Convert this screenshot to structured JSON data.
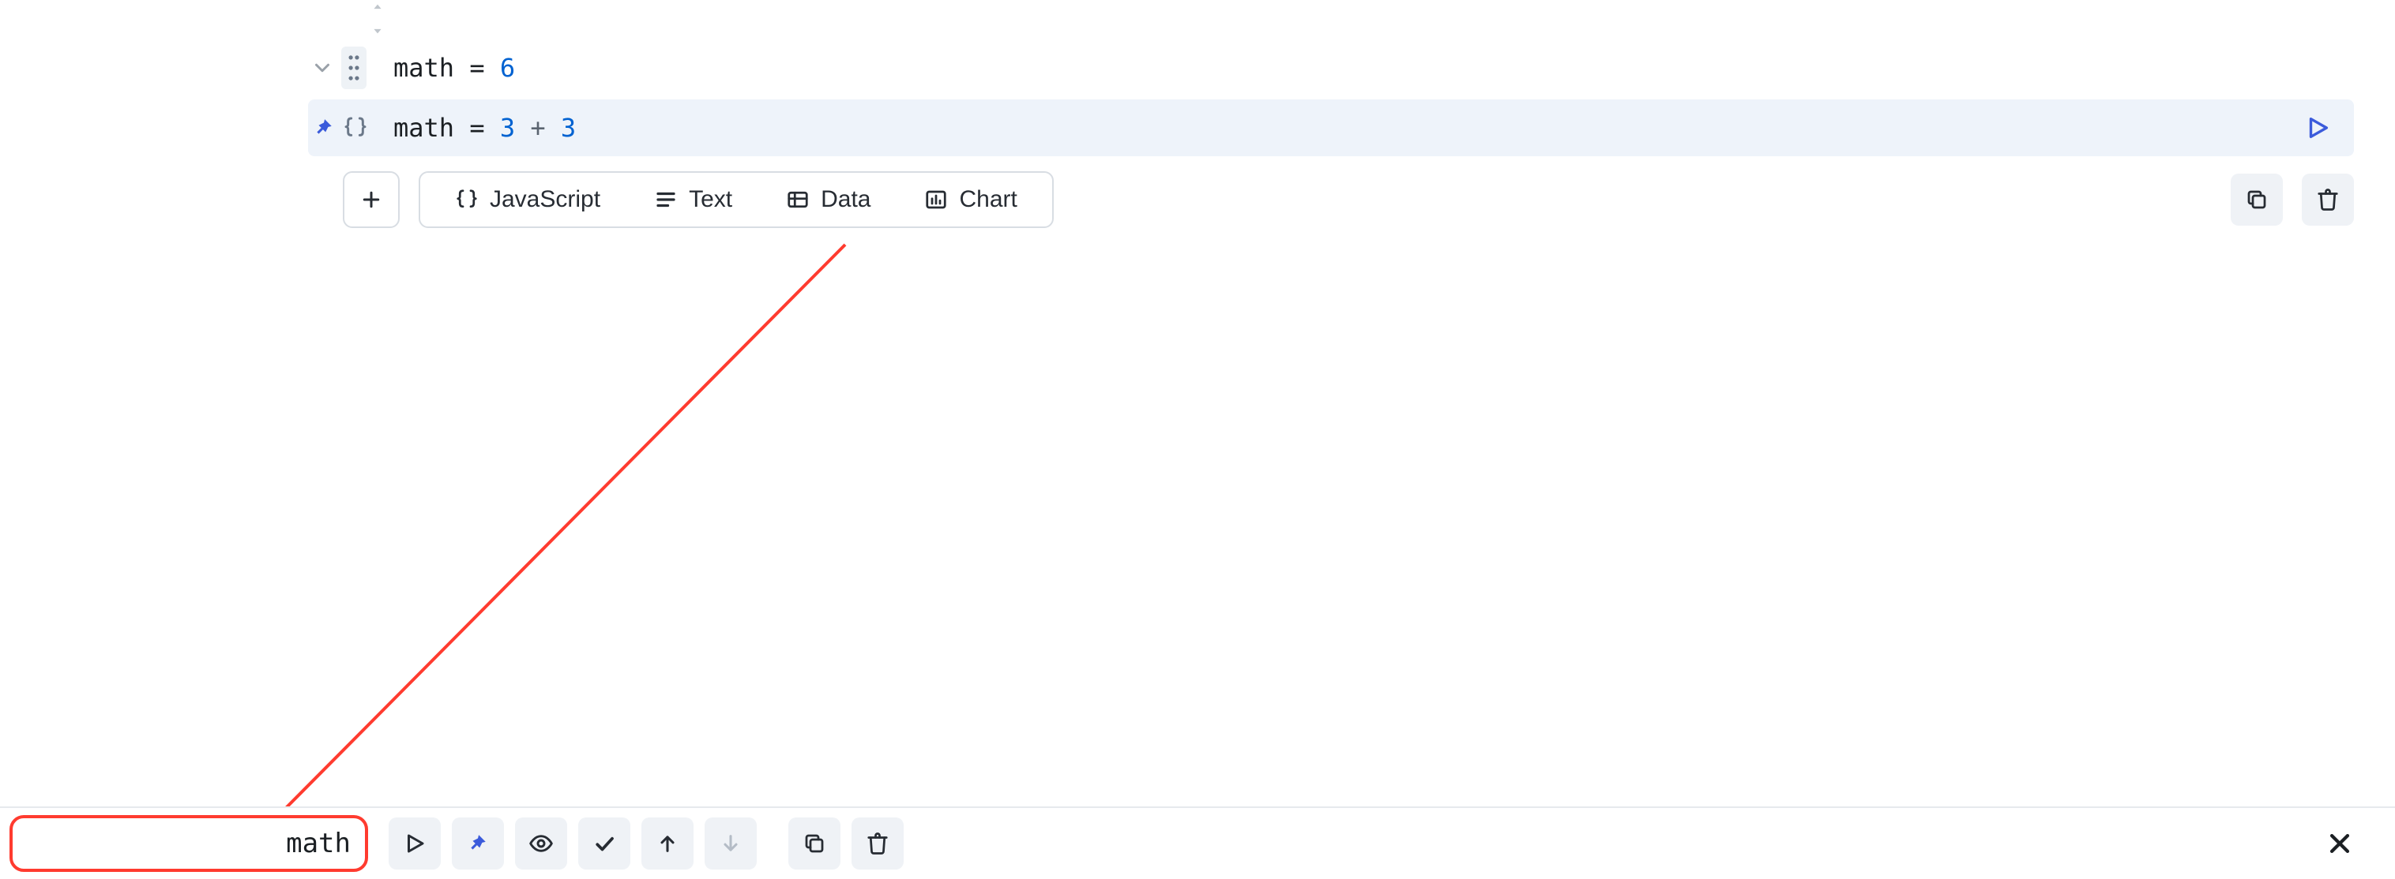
{
  "cell": {
    "result": {
      "name": "math",
      "eq": "=",
      "value": "6"
    },
    "source": {
      "name": "math",
      "eq": "=",
      "lhs": "3",
      "op": "+",
      "rhs": "3"
    }
  },
  "insert_menu": {
    "javascript": "JavaScript",
    "text": "Text",
    "data": "Data",
    "chart": "Chart"
  },
  "bottom": {
    "cell_name": "math"
  }
}
